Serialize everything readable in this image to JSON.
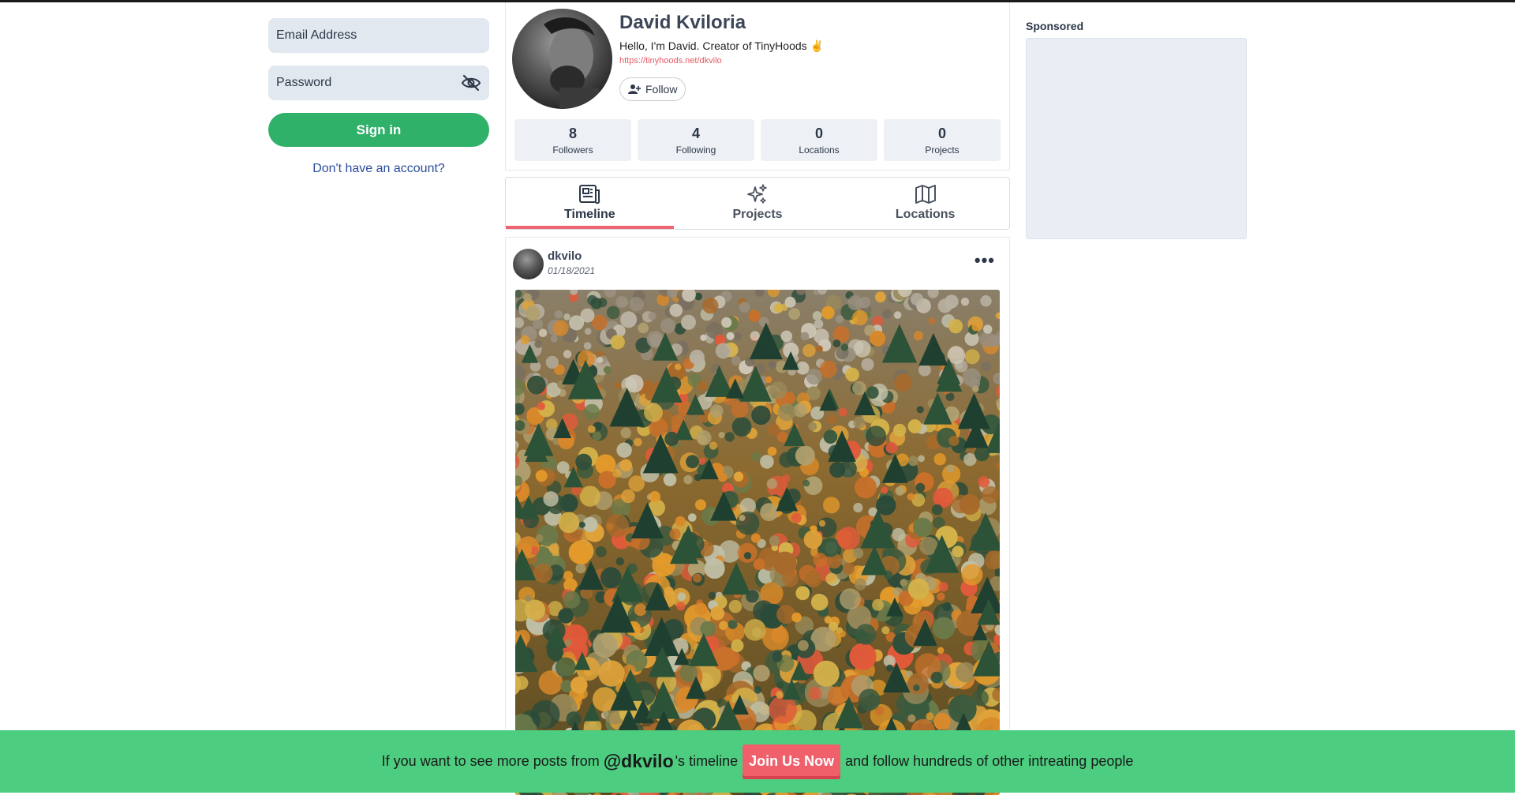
{
  "auth": {
    "email_placeholder": "Email Address",
    "password_placeholder": "Password",
    "signin_label": "Sign in",
    "signup_link": "Don't have an account?"
  },
  "profile": {
    "name": "David Kviloria",
    "bio": "Hello, I'm David. Creator of TinyHoods ✌️",
    "link": "https://tinyhoods.net/dkvilo",
    "follow_label": "Follow",
    "stats": [
      {
        "value": "8",
        "label": "Followers"
      },
      {
        "value": "4",
        "label": "Following"
      },
      {
        "value": "0",
        "label": "Locations"
      },
      {
        "value": "0",
        "label": "Projects"
      }
    ]
  },
  "tabs": [
    {
      "label": "Timeline",
      "icon": "newspaper-icon",
      "active": true
    },
    {
      "label": "Projects",
      "icon": "sparkles-icon",
      "active": false
    },
    {
      "label": "Locations",
      "icon": "map-icon",
      "active": false
    }
  ],
  "post": {
    "username": "dkvilo",
    "date": "01/18/2021",
    "menu_icon": "more-horizontal-icon"
  },
  "sidebar": {
    "sponsored_label": "Sponsored"
  },
  "banner": {
    "prefix": "If you want to see more posts from",
    "handle": "@dkvilo",
    "suffix_timeline": "'s timeline",
    "join_label": "Join Us Now",
    "tail": "and follow hundreds of other intreating people"
  },
  "colors": {
    "accent_green": "#2fb16a",
    "banner_green": "#4dcd7f",
    "accent_red": "#ee6470",
    "input_bg": "#e2e8f0"
  }
}
